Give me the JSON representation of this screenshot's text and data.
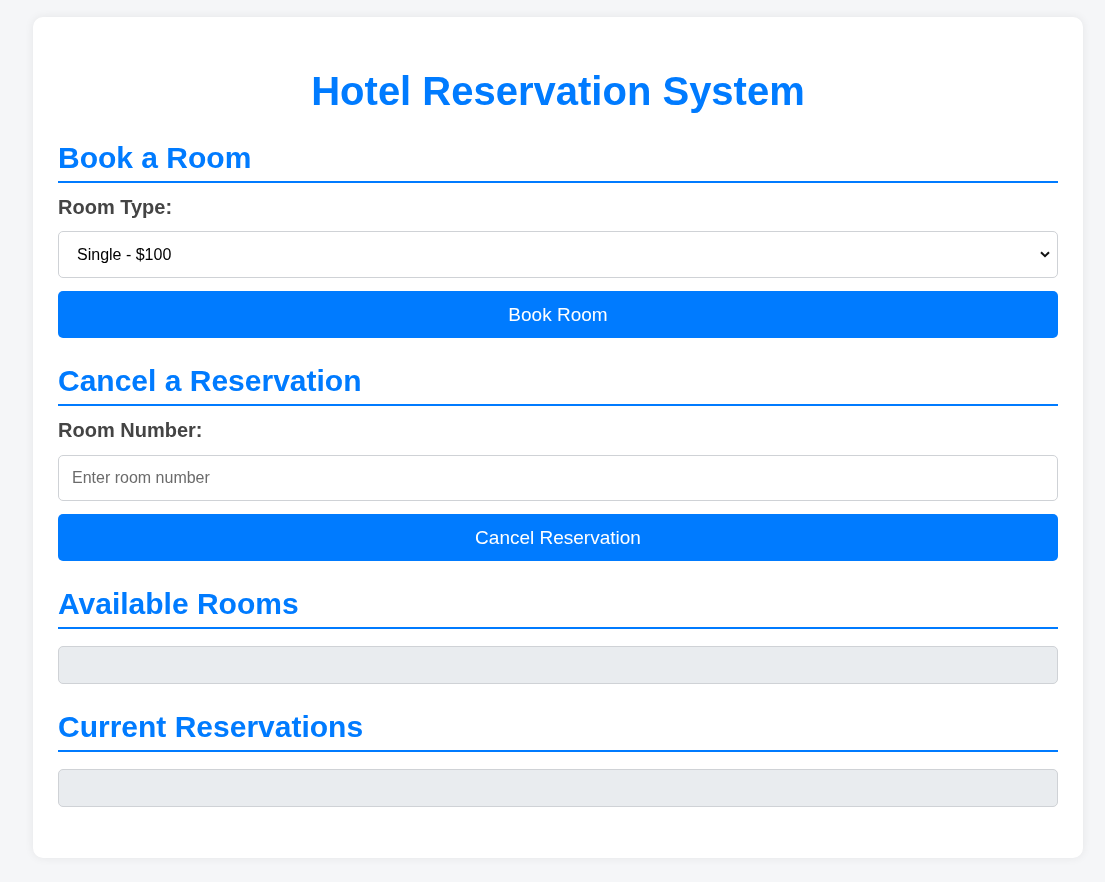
{
  "title": "Hotel Reservation System",
  "sections": [
    {
      "kind": "form",
      "heading": "Book a Room",
      "label": "Room Type:",
      "field": {
        "kind": "select",
        "value": "Single - $100"
      },
      "button": "Book Room"
    },
    {
      "kind": "form",
      "heading": "Cancel a Reservation",
      "label": "Room Number:",
      "field": {
        "kind": "text",
        "placeholder": "Enter room number"
      },
      "button": "Cancel Reservation"
    },
    {
      "kind": "list",
      "heading": "Available Rooms"
    },
    {
      "kind": "list",
      "heading": "Current Reservations"
    }
  ]
}
